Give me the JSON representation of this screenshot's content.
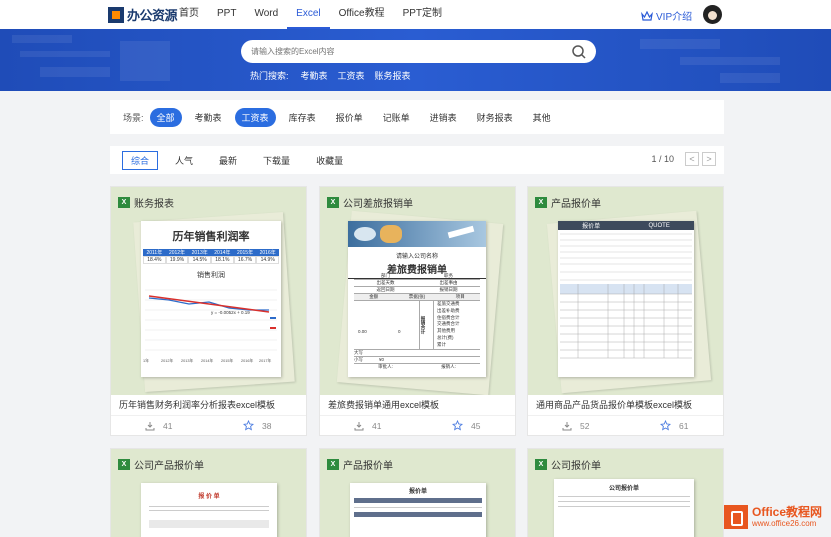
{
  "header": {
    "logo_text": "办公资源",
    "nav": [
      "首页",
      "PPT",
      "Word",
      "Excel",
      "Office教程",
      "PPT定制"
    ],
    "active_nav": "Excel",
    "vip_label": "VIP介绍"
  },
  "search": {
    "placeholder": "请输入搜索的Excel内容",
    "hot_label": "热门搜索:",
    "hot_terms": [
      "考勤表",
      "工资表",
      "账务报表"
    ]
  },
  "filter": {
    "label": "场景:",
    "items": [
      "全部",
      "考勤表",
      "工资表",
      "库存表",
      "报价单",
      "记账单",
      "进销表",
      "财务报表",
      "其他"
    ],
    "active": [
      "全部",
      "工资表"
    ]
  },
  "sort": {
    "items": [
      "综合",
      "人气",
      "最新",
      "下载量",
      "收藏量"
    ],
    "active": "综合",
    "page": "1 / 10",
    "prev": "<",
    "next": ">"
  },
  "cards": [
    {
      "category": "账务报表",
      "title": "历年销售财务利润率分析报表excel模板",
      "downloads": "41",
      "favorites": "38",
      "preview": {
        "heading": "历年销售利润率",
        "years": [
          "2011年",
          "2012年",
          "2013年",
          "2014年",
          "2015年",
          "2016年"
        ],
        "rates": [
          "18.4%",
          "19.9%",
          "14.5%",
          "18.1%",
          "16.7%",
          "14.9%"
        ],
        "chart_title": "销售利润",
        "formula": "y = -0.0052x + 0.19",
        "xyears": [
          "1年",
          "2012年",
          "2013年",
          "2014年",
          "2015年",
          "2016年",
          "2017年"
        ]
      }
    },
    {
      "category": "公司差旅报销单",
      "title": "差旅费报销单通用excel模板",
      "downloads": "41",
      "favorites": "45",
      "preview": {
        "company": "请输入公司名称",
        "heading": "差旅费报销单",
        "r1": [
          "部门",
          "职务"
        ],
        "r2": [
          "出差天数",
          "出差事由"
        ],
        "r3": [
          "返回日期",
          "报销日期"
        ],
        "cols": [
          "金额",
          "票据(张)",
          "项目"
        ],
        "side": [
          "报销合计"
        ],
        "items": [
          "差旅交通费",
          "出差补助费",
          "住宿费合计",
          "交通费合计",
          "其他费用",
          "总计(费)",
          "累计"
        ],
        "total": "0.00",
        "num0": "0",
        "bottom": [
          "大写",
          "小写",
          "¥0"
        ],
        "sign": [
          "审批人:",
          "报销人:"
        ]
      }
    },
    {
      "category": "产品报价单",
      "title": "通用商品产品货品报价单模板excel模板",
      "downloads": "52",
      "favorites": "61",
      "preview": {
        "heading": "报价单",
        "heading_en": "QUOTE"
      }
    },
    {
      "category": "公司产品报价单",
      "heading": "报 价 单"
    },
    {
      "category": "产品报价单",
      "heading": "报价单"
    },
    {
      "category": "公司报价单",
      "heading": "公司报价单"
    }
  ],
  "watermark": {
    "brand": "Office教程网",
    "url": "www.office26.com"
  },
  "colors": {
    "accent": "#2b6de0",
    "banner": "#2352c4",
    "excel_green": "#2e8b3e",
    "watermark": "#e8561f"
  }
}
